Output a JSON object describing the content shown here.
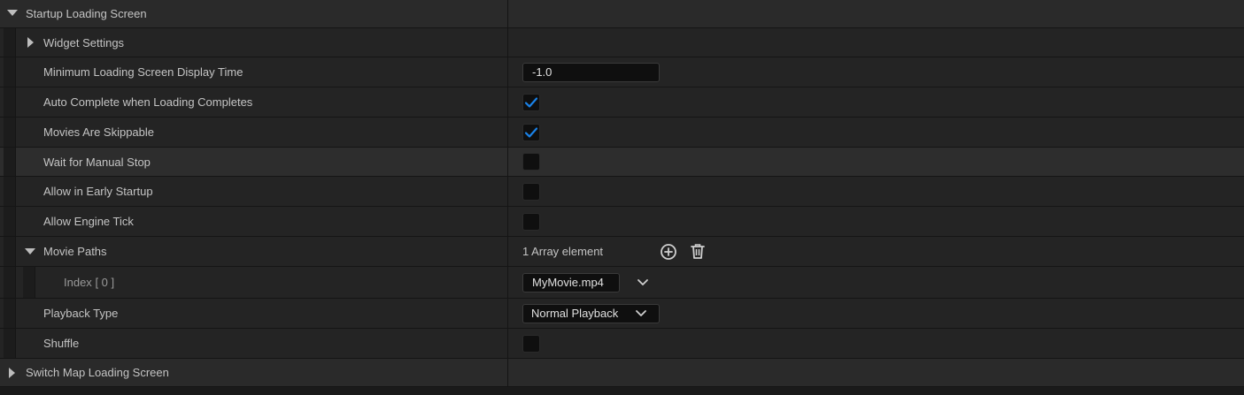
{
  "sections": {
    "startup": {
      "title": "Startup Loading Screen"
    },
    "widget_settings": {
      "label": "Widget Settings"
    },
    "switch_map": {
      "title": "Switch Map Loading Screen"
    }
  },
  "properties": {
    "min_display_time": {
      "label": "Minimum Loading Screen Display Time",
      "value": "-1.0"
    },
    "auto_complete": {
      "label": "Auto Complete when Loading Completes",
      "checked": true
    },
    "movies_skippable": {
      "label": "Movies Are Skippable",
      "checked": true
    },
    "wait_manual_stop": {
      "label": "Wait for Manual Stop",
      "checked": false
    },
    "allow_early_startup": {
      "label": "Allow in Early Startup",
      "checked": false
    },
    "allow_engine_tick": {
      "label": "Allow Engine Tick",
      "checked": false
    },
    "movie_paths": {
      "label": "Movie Paths",
      "summary": "1 Array element",
      "items": [
        {
          "index_label": "Index",
          "index": "[ 0 ]",
          "value": "MyMovie.mp4"
        }
      ]
    },
    "playback_type": {
      "label": "Playback Type",
      "value": "Normal Playback"
    },
    "shuffle": {
      "label": "Shuffle",
      "checked": false
    }
  },
  "icons": {
    "expanded": "triangle-down-icon",
    "collapsed": "triangle-right-icon",
    "check": "checkmark-icon",
    "add": "plus-circle-icon",
    "delete": "trash-icon",
    "dropdown": "chevron-down-icon"
  },
  "colors": {
    "accent_check": "#1a82e8",
    "background": "#242424",
    "field_bg": "#0f0f0f"
  }
}
